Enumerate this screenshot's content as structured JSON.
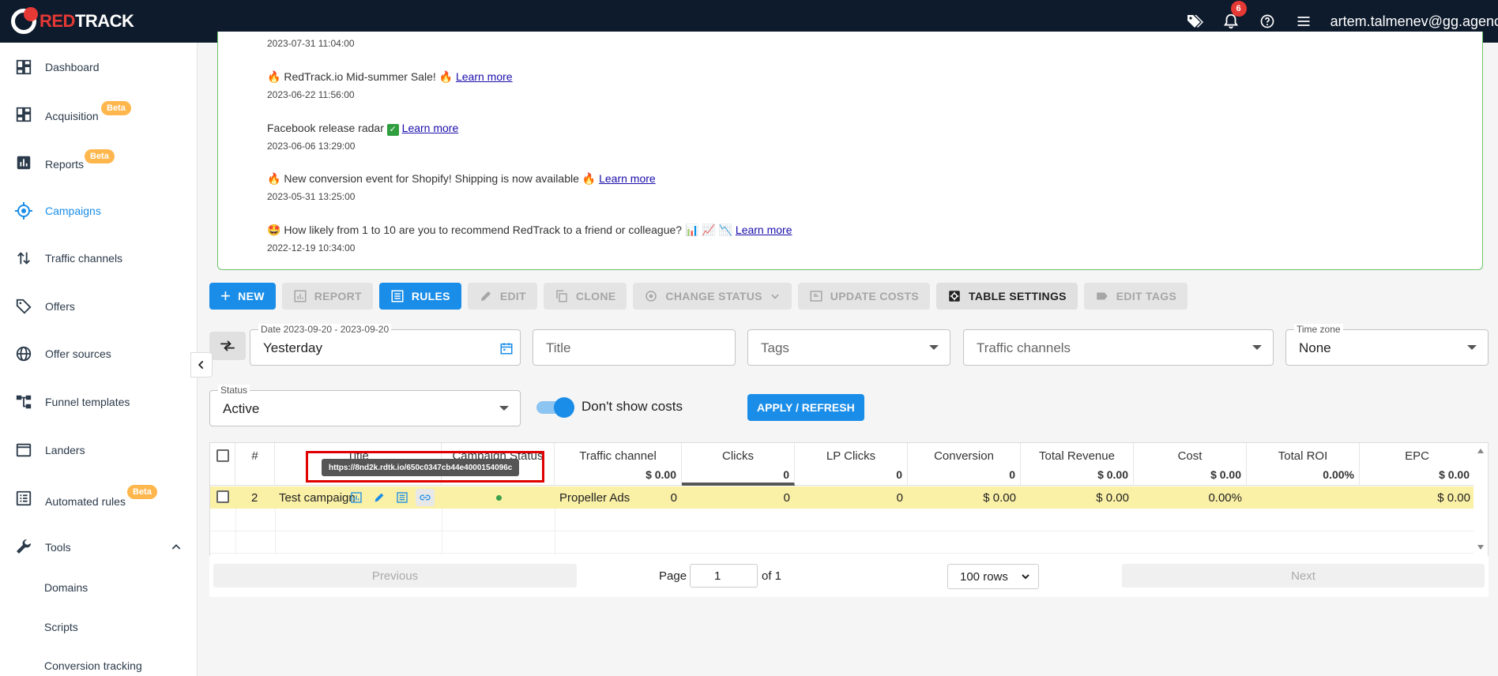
{
  "header": {
    "logo_red": "RED",
    "logo_white": "TRACK",
    "notif_count": "6",
    "user_email": "artem.talmenev@gg.agenc"
  },
  "sidebar": {
    "items": [
      {
        "label": "Dashboard"
      },
      {
        "label": "Acquisition",
        "badge": "Beta"
      },
      {
        "label": "Reports",
        "badge": "Beta"
      },
      {
        "label": "Campaigns"
      },
      {
        "label": "Traffic channels"
      },
      {
        "label": "Offers"
      },
      {
        "label": "Offer sources"
      },
      {
        "label": "Funnel templates"
      },
      {
        "label": "Landers"
      },
      {
        "label": "Automated rules",
        "badge": "Beta"
      },
      {
        "label": "Tools"
      }
    ],
    "tools_sub": [
      "Domains",
      "Scripts",
      "Conversion tracking"
    ]
  },
  "news": {
    "first_date": "2023-07-31 11:04:00",
    "items": [
      {
        "text": "RedTrack.io Mid-summer Sale! ",
        "link": "Learn more",
        "date": "2023-06-22 11:56:00"
      },
      {
        "text": "Facebook release radar ",
        "link": "Learn more",
        "date": "2023-06-06 13:29:00"
      },
      {
        "text": "New conversion event for Shopify! Shipping is now available ",
        "link": "Learn more",
        "date": "2023-05-31 13:25:00"
      },
      {
        "text": "How likely from 1 to 10 are you to recommend RedTrack to a friend or colleague? ",
        "link": "Learn more",
        "date": "2022-12-19 10:34:00"
      }
    ]
  },
  "toolbar": {
    "new": "NEW",
    "report": "REPORT",
    "rules": "RULES",
    "edit": "EDIT",
    "clone": "CLONE",
    "change_status": "CHANGE STATUS",
    "update_costs": "UPDATE COSTS",
    "table_settings": "TABLE SETTINGS",
    "edit_tags": "EDIT TAGS"
  },
  "filters": {
    "date_label": "Date 2023-09-20 - 2023-09-20",
    "date_value": "Yesterday",
    "title_placeholder": "Title",
    "tags_placeholder": "Tags",
    "traffic_placeholder": "Traffic channels",
    "timezone_label": "Time zone",
    "timezone_value": "None",
    "status_label": "Status",
    "status_value": "Active",
    "dont_show_costs": "Don't show costs",
    "apply": "APPLY / REFRESH"
  },
  "table": {
    "headers": {
      "num": "#",
      "title": "Title",
      "status": "Campaign Status",
      "traffic": "Traffic channel",
      "clicks": "Clicks",
      "lp_clicks": "LP Clicks",
      "conversion": "Conversion",
      "revenue": "Total Revenue",
      "cost": "Cost",
      "roi": "Total ROI",
      "epc": "EPC"
    },
    "totals": {
      "traffic": "$ 0.00",
      "clicks": "0",
      "lp_clicks": "0",
      "conversion": "0",
      "revenue": "$ 0.00",
      "cost": "$ 0.00",
      "roi": "0.00%",
      "epc": "$ 0.00"
    },
    "rows": [
      {
        "num": "2",
        "title": "Test campaign",
        "traffic": "Propeller Ads",
        "clicks": "0",
        "lp_clicks": "0",
        "conversion": "0",
        "revenue": "$ 0.00",
        "cost": "$ 0.00",
        "roi": "0.00%",
        "epc": "$ 0.00"
      }
    ],
    "tooltip": "https://8nd2k.rdtk.io/650c0347cb44e4000154096c"
  },
  "pagination": {
    "previous": "Previous",
    "page_label": "Page",
    "page_value": "1",
    "of_label": "of 1",
    "rows_value": "100 rows",
    "next": "Next"
  },
  "colors": {
    "topbar": "#0e1b2c",
    "primary": "#1a8de8",
    "row_highlight": "#faf0a6",
    "news_border": "#6cc36c",
    "badge": "#ffb74d",
    "red_box": "#e00000"
  }
}
